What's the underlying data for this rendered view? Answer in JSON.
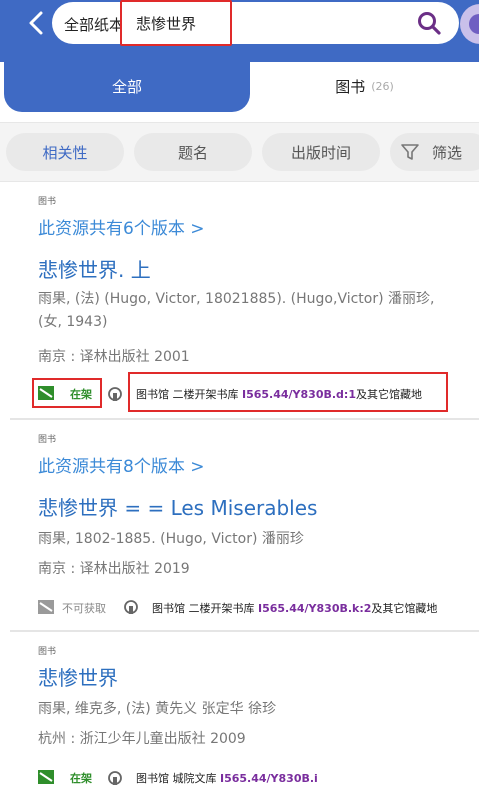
{
  "header": {
    "scope_label": "全部纸本资源",
    "query": "悲惨世界"
  },
  "tabs": {
    "all_label": "全部",
    "books_label": "图书",
    "books_count": "(26)"
  },
  "sort": {
    "relevance": "相关性",
    "title": "题名",
    "pub_date": "出版时间",
    "filter": "筛选"
  },
  "records": [
    {
      "type": "图书",
      "versions": "此资源共有6个版本 >",
      "title": "悲惨世界. 上",
      "author": "雨果, (法) (Hugo, Victor, 18021885). (Hugo,Victor) 潘丽珍, (女, 1943)",
      "publisher": "南京 : 译林出版社 2001",
      "status": "在架",
      "location": "图书馆 二楼开架书库 ",
      "call_number": "I565.44/Y830B.d:1",
      "suffix": "及其它馆藏地"
    },
    {
      "type": "图书",
      "versions": "此资源共有8个版本 >",
      "title": "悲惨世界 = = Les Miserables",
      "author": "雨果, 1802-1885. (Hugo, Victor) 潘丽珍",
      "publisher": "南京 : 译林出版社 2019",
      "status": "不可获取",
      "location": "图书馆 二楼开架书库 ",
      "call_number": "I565.44/Y830B.k:2",
      "suffix": "及其它馆藏地"
    },
    {
      "type": "图书",
      "title": "悲惨世界",
      "author": "雨果, 维克多, (法) 黄先义 张定华 徐珍",
      "publisher": "杭州 : 浙江少年儿童出版社 2009",
      "status": "在架",
      "location": "图书馆 城院文库 ",
      "call_number": "I565.44/Y830B.i"
    }
  ],
  "colors": {
    "brand_blue": "#3f6ac4",
    "link_blue": "#3c8ad7",
    "available_green": "#2f8e2b",
    "call_number_purple": "#7a2e9e",
    "highlight_red": "#e02a2a"
  }
}
